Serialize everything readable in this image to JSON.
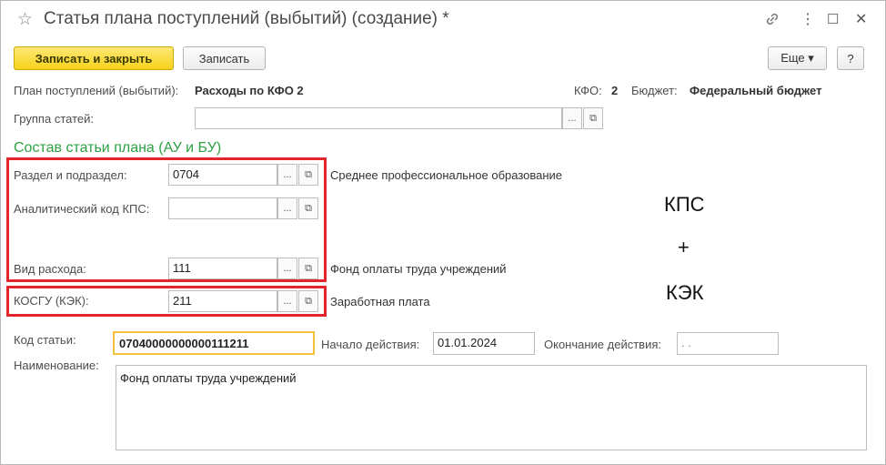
{
  "window": {
    "title": "Статья плана поступлений (выбытий) (создание) *",
    "star_glyph": "☆",
    "link_glyph": "🔗",
    "more_glyph": "⋮",
    "maximize_glyph": "☐",
    "close_glyph": "✕"
  },
  "toolbar": {
    "save_close_label": "Записать и закрыть",
    "save_label": "Записать",
    "more_label": "Еще ▾",
    "help_label": "?"
  },
  "plan": {
    "label": "План поступлений (выбытий):",
    "value": "Расходы по КФО 2",
    "kfo_label": "КФО:",
    "kfo_value": "2",
    "budget_label": "Бюджет:",
    "budget_value": "Федеральный бюджет"
  },
  "group": {
    "label": "Группа статей:",
    "value": ""
  },
  "section_title": "Состав статьи плана (АУ и БУ)",
  "fields": {
    "razdel": {
      "label": "Раздел и подраздел:",
      "value": "0704",
      "description": "Среднее профессиональное образование"
    },
    "kps": {
      "label": "Аналитический код КПС:",
      "value": "",
      "description": ""
    },
    "vid": {
      "label": "Вид расхода:",
      "value": "111",
      "description": "Фонд оплаты труда учреждений"
    },
    "kosgu": {
      "label": "КОСГУ (КЭК):",
      "value": "211",
      "description": "Заработная плата"
    }
  },
  "select_btn": "...",
  "open_btn": "⧉",
  "annotation": {
    "line1": "КПС",
    "line2": "+",
    "line3": "КЭК"
  },
  "code": {
    "label": "Код статьи:",
    "value": "07040000000000111211",
    "start_label": "Начало действия:",
    "start_value": "01.01.2024",
    "end_label": "Окончание действия:",
    "end_value": " .  ."
  },
  "name": {
    "label": "Наименование:",
    "value": "Фонд оплаты труда учреждений"
  },
  "colors": {
    "accent_yellow": "#f6d21c",
    "section_green": "#2ea043",
    "highlight_red": "#e3262b"
  }
}
